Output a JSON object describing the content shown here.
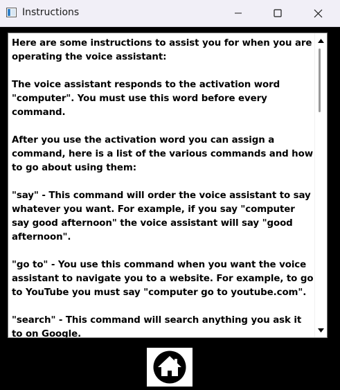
{
  "window": {
    "title": "Instructions"
  },
  "content": {
    "paragraphs": [
      "Here are some instructions to assist you for when you are operating the voice assistant:",
      "The voice assistant responds to the activation word \"computer\". You must use this word before every command.",
      "After you use the activation word you can assign a command, here is a list of the various commands and how to go about using them:",
      "\"say\" - This command will order the voice assistant to say whatever you want. For example, if you say \"computer say good afternoon\" the voice assistant will say \"good afternoon\".",
      "\"go to\" - You use this command when you want the voice assistant to navigate you to a website. For example, to go to YouTube you must say \"computer go to youtube.com\".",
      "\"search\" - This command will search anything you ask it to on Google."
    ]
  },
  "icons": {
    "app": "window-app-icon",
    "minimize": "minimize-icon",
    "maximize": "maximize-icon",
    "close": "close-icon",
    "scroll_up": "scroll-up-arrow-icon",
    "scroll_down": "scroll-down-arrow-icon",
    "home": "home-icon"
  }
}
